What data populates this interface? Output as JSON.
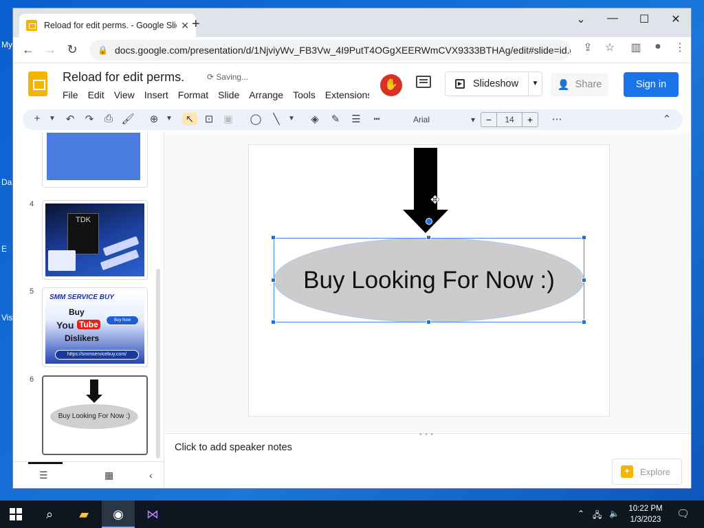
{
  "browser": {
    "tab_title": "Reload for edit perms. - Google Slides",
    "url": "docs.google.com/presentation/d/1NjviyWv_FB3Vw_4I9PutT4OGgXEERWmCVX9333BTHAg/edit#slide=id.g..."
  },
  "app": {
    "doc_title": "Reload for edit perms.",
    "status": "Saving...",
    "menu": [
      "File",
      "Edit",
      "View",
      "Insert",
      "Format",
      "Slide",
      "Arrange",
      "Tools",
      "Extensions"
    ],
    "slideshow_label": "Slideshow",
    "share_label": "Share",
    "signin_label": "Sign in"
  },
  "toolbar": {
    "font": "Arial",
    "font_size": "14"
  },
  "filmstrip": {
    "slide_numbers": [
      "4",
      "5",
      "6"
    ],
    "slide4_label": "TDK",
    "slide5": {
      "header": "SMM SERVICE BUY",
      "buy": "Buy",
      "you": "You",
      "tube": "Tube",
      "dislikers": "Dislikers",
      "button": "Buy Now",
      "url": "https://smmservicebuy.com/"
    },
    "slide6_text": "Buy Looking For Now :)"
  },
  "canvas": {
    "shape_text": "Buy Looking For Now :)"
  },
  "notes": {
    "placeholder": "Click to add speaker notes",
    "explore_label": "Explore"
  },
  "taskbar": {
    "time": "10:22 PM",
    "date": "1/3/2023"
  },
  "colors": {
    "accent": "#1a73e8",
    "slides_yellow": "#f4b400",
    "ellipse_fill": "#cccccc"
  }
}
